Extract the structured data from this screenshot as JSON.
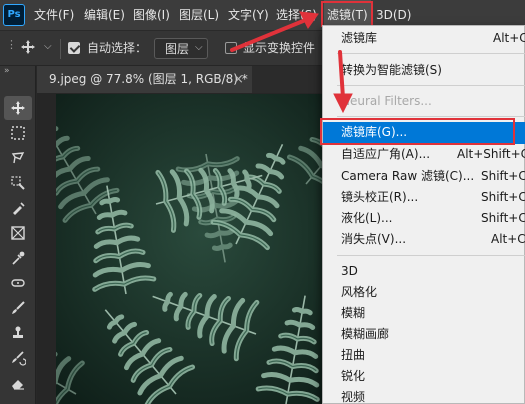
{
  "app": {
    "logo_text": "Ps"
  },
  "menubar": {
    "items": [
      "文件(F)",
      "编辑(E)",
      "图像(I)",
      "图层(L)",
      "文字(Y)",
      "选择(S)",
      "滤镜(T)",
      "3D(D)"
    ],
    "active_index": 6
  },
  "options_bar": {
    "auto_select_label": "自动选择：",
    "auto_select_checked": true,
    "layer_select_value": "图层",
    "show_transform_label": "显示变换控件",
    "show_transform_checked": false
  },
  "document": {
    "tab_title": "9.jpeg @ 77.8% (图层 1, RGB/8) *",
    "close_glyph": "×"
  },
  "filter_menu": {
    "items": [
      {
        "label": "滤镜库",
        "shortcut": "Alt+Ct"
      },
      {
        "label": "转换为智能滤镜(S)",
        "shortcut": ""
      },
      {
        "label": "Neural Filters...",
        "shortcut": "",
        "disabled": true
      },
      {
        "label": "滤镜库(G)...",
        "shortcut": "",
        "selected": true
      },
      {
        "label": "自适应广角(A)...",
        "shortcut": "Alt+Shift+Ct"
      },
      {
        "label": "Camera Raw 滤镜(C)...",
        "shortcut": "Shift+Ct"
      },
      {
        "label": "镜头校正(R)...",
        "shortcut": "Shift+Ct"
      },
      {
        "label": "液化(L)...",
        "shortcut": "Shift+Ct"
      },
      {
        "label": "消失点(V)...",
        "shortcut": "Alt+Ct"
      },
      {
        "label": "3D",
        "shortcut": ""
      },
      {
        "label": "风格化",
        "shortcut": ""
      },
      {
        "label": "模糊",
        "shortcut": ""
      },
      {
        "label": "模糊画廊",
        "shortcut": ""
      },
      {
        "label": "扭曲",
        "shortcut": ""
      },
      {
        "label": "锐化",
        "shortcut": ""
      },
      {
        "label": "视频",
        "shortcut": ""
      }
    ]
  },
  "colors": {
    "highlight_red": "#e0323a",
    "menu_selected_blue": "#0078d7",
    "ps_blue": "#31a8ff"
  },
  "tools": [
    "move-tool",
    "marquee-tool",
    "lasso-tool",
    "quick-select-tool",
    "crop-tool",
    "frame-tool",
    "eyedropper-tool",
    "healing-tool",
    "brush-tool",
    "stamp-tool",
    "history-brush-tool",
    "eraser-tool"
  ]
}
